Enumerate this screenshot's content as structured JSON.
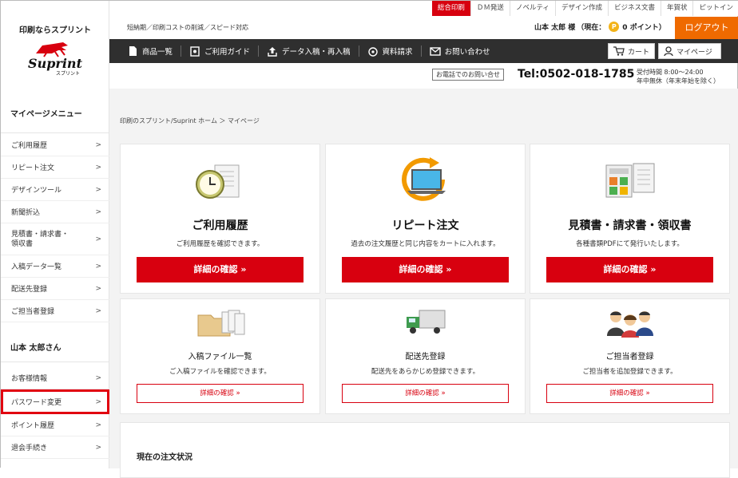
{
  "sidebar": {
    "brand_tag": "印刷ならスプリント",
    "logo_text": "Suprint",
    "logo_sub": "スプリント",
    "menu_title": "マイページメニュー",
    "items": [
      {
        "label": "ご利用履歴"
      },
      {
        "label": "リピート注文"
      },
      {
        "label": "デザインツール"
      },
      {
        "label": "新聞折込"
      },
      {
        "label": "見積書・請求書・\n領収書"
      },
      {
        "label": "入稿データ一覧"
      },
      {
        "label": "配送先登録"
      },
      {
        "label": "ご担当者登録"
      }
    ],
    "user_title": "山本 太郎さん",
    "user_items": [
      {
        "label": "お客様情報"
      },
      {
        "label": "パスワード変更"
      },
      {
        "label": "ポイント履歴"
      },
      {
        "label": "退会手続き"
      }
    ],
    "chevron": ">"
  },
  "topnav": [
    "総合印刷",
    "ＤＭ発送",
    "ノベルティ",
    "デザイン作成",
    "ビジネス文書",
    "年賀状",
    "ピットイン"
  ],
  "header": {
    "tagline": "短納期／印刷コストの削減／スピード対応",
    "user_name": "山本 太郎 様",
    "status_prefix": "（現在：",
    "points_icon": "P",
    "points": "0 ポイント）",
    "logout": "ログアウト"
  },
  "navbar": {
    "items": [
      {
        "label": "商品一覧",
        "icon": "document-icon"
      },
      {
        "label": "ご利用ガイド",
        "icon": "guide-icon"
      },
      {
        "label": "データ入稿・再入稿",
        "icon": "upload-icon"
      },
      {
        "label": "資料請求",
        "icon": "catalog-icon"
      },
      {
        "label": "お問い合わせ",
        "icon": "mail-icon"
      }
    ],
    "cart": "カート",
    "mypage": "マイページ"
  },
  "contact": {
    "label": "お電話でのお問い合せ",
    "phone": "Tel:0502-018-1785",
    "hours_line1": "受付時間 8:00～24:00",
    "hours_line2": "年中無休（年末年始を除く）"
  },
  "breadcrumb": "印刷のスプリント/Suprint ホーム ＞ マイページ",
  "cards": [
    {
      "title": "ご利用履歴",
      "desc": "ご利用履歴を確認できます。",
      "button": "詳細の確認 »",
      "icon": "clock-document-icon"
    },
    {
      "title": "リピート注文",
      "desc": "過去の注文履歴と同じ内容をカートに入れます。",
      "button": "詳細の確認 »",
      "icon": "repeat-laptop-icon"
    },
    {
      "title": "見積書・請求書・領収書",
      "desc": "各種書類PDFにて発行いたします。",
      "button": "詳細の確認 »",
      "icon": "calculator-document-icon"
    },
    {
      "title": "入稿ファイル一覧",
      "desc": "ご入稿ファイルを確認できます。",
      "button": "詳細の確認 »",
      "icon": "folder-files-icon"
    },
    {
      "title": "配送先登録",
      "desc": "配送先をあらかじめ登録できます。",
      "button": "詳細の確認 »",
      "icon": "truck-icon"
    },
    {
      "title": "ご担当者登録",
      "desc": "ご担当者を追加登録できます。",
      "button": "詳細の確認 »",
      "icon": "people-icon"
    }
  ],
  "order_status_title": "現在の注文状況",
  "colors": {
    "accent": "#d8000f",
    "logout": "#ef6a00",
    "navbar": "#2f2f2f"
  }
}
